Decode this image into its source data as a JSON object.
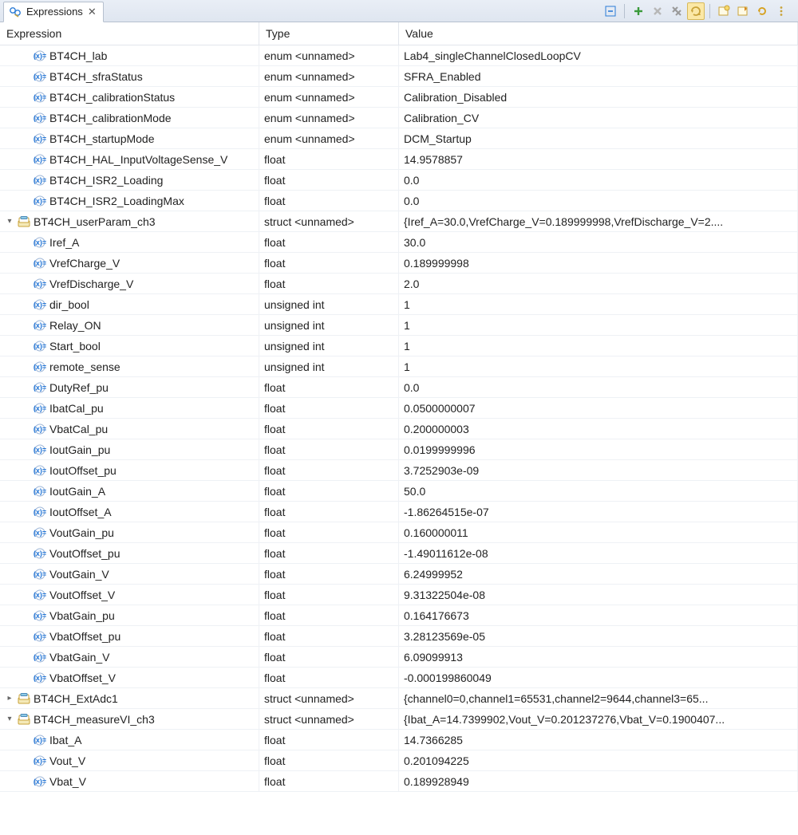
{
  "tab": {
    "title": "Expressions"
  },
  "columns": {
    "expr": "Expression",
    "type": "Type",
    "value": "Value"
  },
  "rows": [
    {
      "indent": 1,
      "twisty": "",
      "icon": "var",
      "name": "BT4CH_lab",
      "type": "enum <unnamed>",
      "value": "Lab4_singleChannelClosedLoopCV"
    },
    {
      "indent": 1,
      "twisty": "",
      "icon": "var",
      "name": "BT4CH_sfraStatus",
      "type": "enum <unnamed>",
      "value": "SFRA_Enabled"
    },
    {
      "indent": 1,
      "twisty": "",
      "icon": "var",
      "name": "BT4CH_calibrationStatus",
      "type": "enum <unnamed>",
      "value": "Calibration_Disabled"
    },
    {
      "indent": 1,
      "twisty": "",
      "icon": "var",
      "name": "BT4CH_calibrationMode",
      "type": "enum <unnamed>",
      "value": "Calibration_CV"
    },
    {
      "indent": 1,
      "twisty": "",
      "icon": "var",
      "name": "BT4CH_startupMode",
      "type": "enum <unnamed>",
      "value": "DCM_Startup"
    },
    {
      "indent": 1,
      "twisty": "",
      "icon": "var",
      "name": "BT4CH_HAL_InputVoltageSense_V",
      "type": "float",
      "value": "14.9578857"
    },
    {
      "indent": 1,
      "twisty": "",
      "icon": "var",
      "name": "BT4CH_ISR2_Loading",
      "type": "float",
      "value": "0.0"
    },
    {
      "indent": 1,
      "twisty": "",
      "icon": "var",
      "name": "BT4CH_ISR2_LoadingMax",
      "type": "float",
      "value": "0.0"
    },
    {
      "indent": 0,
      "twisty": "v",
      "icon": "struct",
      "name": "BT4CH_userParam_ch3",
      "type": "struct <unnamed>",
      "value": "{Iref_A=30.0,VrefCharge_V=0.189999998,VrefDischarge_V=2...."
    },
    {
      "indent": 1,
      "twisty": "",
      "icon": "var",
      "name": "Iref_A",
      "type": "float",
      "value": "30.0"
    },
    {
      "indent": 1,
      "twisty": "",
      "icon": "var",
      "name": "VrefCharge_V",
      "type": "float",
      "value": "0.189999998",
      "selected": true
    },
    {
      "indent": 1,
      "twisty": "",
      "icon": "var",
      "name": "VrefDischarge_V",
      "type": "float",
      "value": "2.0"
    },
    {
      "indent": 1,
      "twisty": "",
      "icon": "var",
      "name": "dir_bool",
      "type": "unsigned int",
      "value": "1"
    },
    {
      "indent": 1,
      "twisty": "",
      "icon": "var",
      "name": "Relay_ON",
      "type": "unsigned int",
      "value": "1"
    },
    {
      "indent": 1,
      "twisty": "",
      "icon": "var",
      "name": "Start_bool",
      "type": "unsigned int",
      "value": "1"
    },
    {
      "indent": 1,
      "twisty": "",
      "icon": "var",
      "name": "remote_sense",
      "type": "unsigned int",
      "value": "1"
    },
    {
      "indent": 1,
      "twisty": "",
      "icon": "var",
      "name": "DutyRef_pu",
      "type": "float",
      "value": "0.0"
    },
    {
      "indent": 1,
      "twisty": "",
      "icon": "var",
      "name": "IbatCal_pu",
      "type": "float",
      "value": "0.0500000007"
    },
    {
      "indent": 1,
      "twisty": "",
      "icon": "var",
      "name": "VbatCal_pu",
      "type": "float",
      "value": "0.200000003"
    },
    {
      "indent": 1,
      "twisty": "",
      "icon": "var",
      "name": "IoutGain_pu",
      "type": "float",
      "value": "0.0199999996"
    },
    {
      "indent": 1,
      "twisty": "",
      "icon": "var",
      "name": "IoutOffset_pu",
      "type": "float",
      "value": "3.7252903e-09"
    },
    {
      "indent": 1,
      "twisty": "",
      "icon": "var",
      "name": "IoutGain_A",
      "type": "float",
      "value": "50.0"
    },
    {
      "indent": 1,
      "twisty": "",
      "icon": "var",
      "name": "IoutOffset_A",
      "type": "float",
      "value": "-1.86264515e-07"
    },
    {
      "indent": 1,
      "twisty": "",
      "icon": "var",
      "name": "VoutGain_pu",
      "type": "float",
      "value": "0.160000011"
    },
    {
      "indent": 1,
      "twisty": "",
      "icon": "var",
      "name": "VoutOffset_pu",
      "type": "float",
      "value": "-1.49011612e-08"
    },
    {
      "indent": 1,
      "twisty": "",
      "icon": "var",
      "name": "VoutGain_V",
      "type": "float",
      "value": "6.24999952"
    },
    {
      "indent": 1,
      "twisty": "",
      "icon": "var",
      "name": "VoutOffset_V",
      "type": "float",
      "value": "9.31322504e-08"
    },
    {
      "indent": 1,
      "twisty": "",
      "icon": "var",
      "name": "VbatGain_pu",
      "type": "float",
      "value": "0.164176673"
    },
    {
      "indent": 1,
      "twisty": "",
      "icon": "var",
      "name": "VbatOffset_pu",
      "type": "float",
      "value": "3.28123569e-05"
    },
    {
      "indent": 1,
      "twisty": "",
      "icon": "var",
      "name": "VbatGain_V",
      "type": "float",
      "value": "6.09099913"
    },
    {
      "indent": 1,
      "twisty": "",
      "icon": "var",
      "name": "VbatOffset_V",
      "type": "float",
      "value": "-0.000199860049"
    },
    {
      "indent": 0,
      "twisty": ">",
      "icon": "struct",
      "name": "BT4CH_ExtAdc1",
      "type": "struct <unnamed>",
      "value": "{channel0=0,channel1=65531,channel2=9644,channel3=65...",
      "highlight": true
    },
    {
      "indent": 0,
      "twisty": "v",
      "icon": "struct",
      "name": "BT4CH_measureVI_ch3",
      "type": "struct <unnamed>",
      "value": "{Ibat_A=14.7399902,Vout_V=0.201237276,Vbat_V=0.1900407...",
      "highlight": true
    },
    {
      "indent": 1,
      "twisty": "",
      "icon": "var",
      "name": "Ibat_A",
      "type": "float",
      "value": "14.7366285",
      "highlight": true
    },
    {
      "indent": 1,
      "twisty": "",
      "icon": "var",
      "name": "Vout_V",
      "type": "float",
      "value": "0.201094225",
      "highlight": true
    },
    {
      "indent": 1,
      "twisty": "",
      "icon": "var",
      "name": "Vbat_V",
      "type": "float",
      "value": "0.189928949",
      "highlight": true
    }
  ]
}
